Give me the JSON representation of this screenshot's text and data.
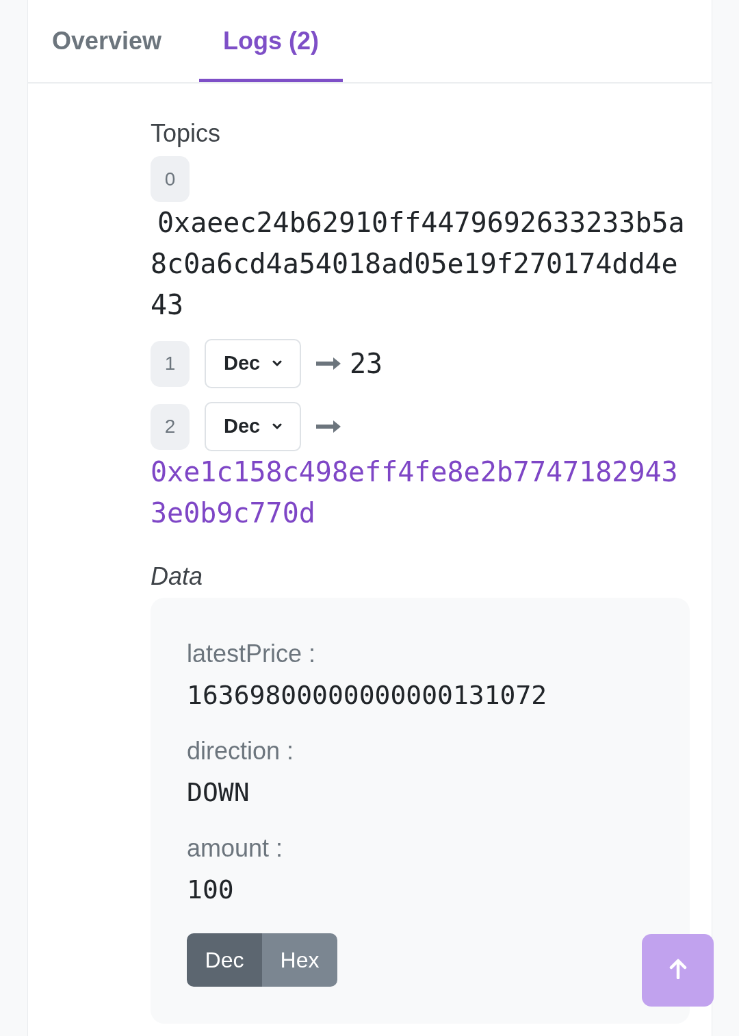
{
  "tabs": [
    {
      "label": "Overview",
      "selected": false
    },
    {
      "label": "Logs (2)",
      "selected": true
    }
  ],
  "topics": {
    "title": "Topics",
    "items": [
      {
        "kind": "raw",
        "index": "0",
        "value": "0xaeec24b62910ff4479692633233b5a8c0a6cd4a54018ad05e19f270174dd4e43"
      },
      {
        "kind": "decoded",
        "index": "1",
        "format": "Dec",
        "value": "23",
        "link": false
      },
      {
        "kind": "decoded",
        "index": "2",
        "format": "Dec",
        "value": "0xe1c158c498eff4fe8e2b77471829433e0b9c770d",
        "link": true
      }
    ]
  },
  "data": {
    "title": "Data",
    "fields": [
      {
        "label": "latestPrice :",
        "value": "16369800000000000131072"
      },
      {
        "label": "direction :",
        "value": "DOWN"
      },
      {
        "label": "amount :",
        "value": "100"
      }
    ],
    "format_toggle": [
      {
        "label": "Dec",
        "selected": true
      },
      {
        "label": "Hex",
        "selected": false
      }
    ]
  }
}
